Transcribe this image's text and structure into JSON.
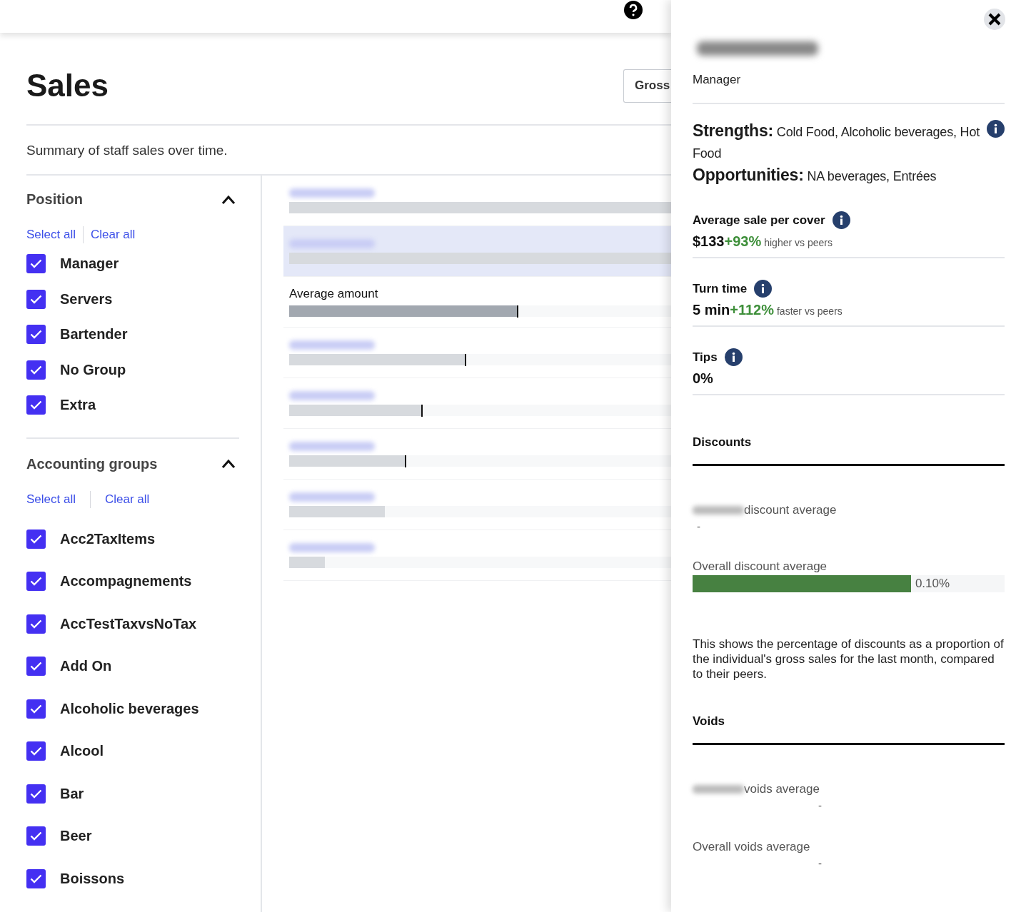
{
  "page": {
    "title": "Sales",
    "metric_button": "Gross",
    "subtitle": "Summary of staff sales over time."
  },
  "filters": [
    {
      "title": "Position",
      "expanded": true,
      "select_all": "Select all",
      "clear_all": "Clear all",
      "items": [
        {
          "label": "Manager",
          "checked": true
        },
        {
          "label": "Servers",
          "checked": true
        },
        {
          "label": "Bartender",
          "checked": true
        },
        {
          "label": "No Group",
          "checked": true
        },
        {
          "label": "Extra",
          "checked": true
        }
      ]
    },
    {
      "title": "Accounting groups",
      "expanded": true,
      "select_all": "Select all",
      "clear_all": "Clear all",
      "items": [
        {
          "label": "Acc2TaxItems",
          "checked": true
        },
        {
          "label": "Accompagnements",
          "checked": true
        },
        {
          "label": "AccTestTaxvsNoTax",
          "checked": true
        },
        {
          "label": "Add On",
          "checked": true
        },
        {
          "label": "Alcoholic beverages",
          "checked": true
        },
        {
          "label": "Alcool",
          "checked": true
        },
        {
          "label": "Bar",
          "checked": true
        },
        {
          "label": "Beer",
          "checked": true
        },
        {
          "label": "Boissons",
          "checked": true
        }
      ]
    }
  ],
  "chart_rows": [
    {
      "kind": "staff",
      "level": 1,
      "marker": false,
      "selected": false
    },
    {
      "kind": "staff",
      "level": 1,
      "marker": false,
      "selected": true
    },
    {
      "kind": "average",
      "label": "Average amount",
      "level": 0.57,
      "marker": true,
      "selected": false
    },
    {
      "kind": "staff",
      "level": 0.44,
      "marker": true,
      "selected": false
    },
    {
      "kind": "staff",
      "level": 0.33,
      "marker": true,
      "selected": false
    },
    {
      "kind": "staff",
      "level": 0.29,
      "marker": true,
      "selected": false
    },
    {
      "kind": "staff",
      "level": 0.24,
      "marker": false,
      "selected": false
    },
    {
      "kind": "staff",
      "level": 0.09,
      "marker": false,
      "selected": false
    }
  ],
  "panel": {
    "role": "Manager",
    "strengths_label": "Strengths:",
    "strengths": "Cold Food, Alcoholic beverages, Hot Food",
    "opportunities_label": "Opportunities:",
    "opportunities": "NA beverages, Entrées",
    "metrics": [
      {
        "label": "Average sale per cover",
        "value": "$133",
        "change": "+93%",
        "note": "higher vs peers"
      },
      {
        "label": "Turn time",
        "value": "5 min",
        "change": "+112%",
        "note": "faster vs peers"
      },
      {
        "label": "Tips",
        "value": "0%"
      }
    ],
    "sections": [
      {
        "title": "Discounts",
        "own_label": "discount average",
        "own_value": "-",
        "overall_label": "Overall discount average",
        "level": 0.7,
        "overall_value": "0.10%",
        "description": "This shows the percentage of discounts as a proportion of the individual's gross sales for the last month, compared to their peers."
      },
      {
        "title": "Voids",
        "own_label": "voids average",
        "own_value": "-",
        "overall_label": "Overall voids average",
        "overall_value": "-"
      }
    ]
  }
}
